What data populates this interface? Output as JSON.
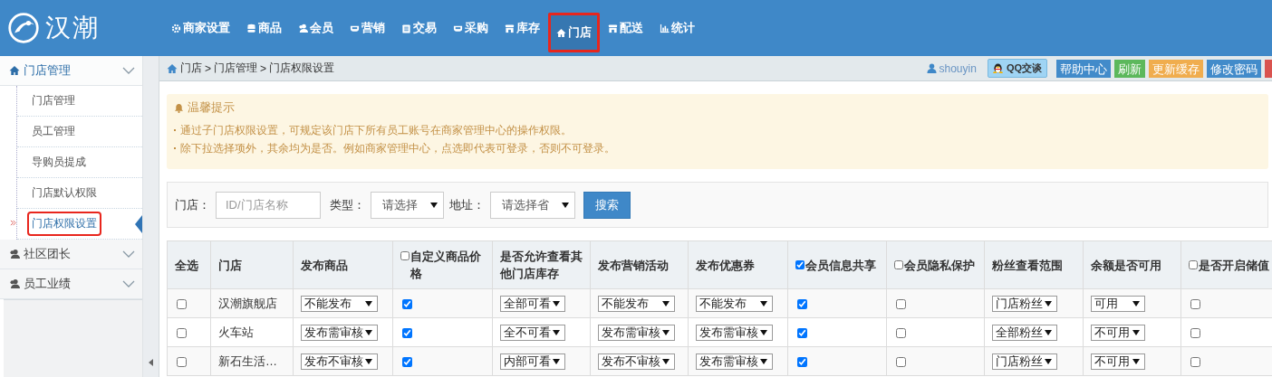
{
  "header": {
    "logo_text": "汉潮",
    "nav": [
      {
        "label": "商家设置",
        "selected": false,
        "highlighted": false
      },
      {
        "label": "商品",
        "selected": false,
        "highlighted": false
      },
      {
        "label": "会员",
        "selected": false,
        "highlighted": false
      },
      {
        "label": "营销",
        "selected": false,
        "highlighted": false
      },
      {
        "label": "交易",
        "selected": false,
        "highlighted": false
      },
      {
        "label": "采购",
        "selected": false,
        "highlighted": false
      },
      {
        "label": "库存",
        "selected": false,
        "highlighted": false
      },
      {
        "label": "门店",
        "selected": true,
        "highlighted": true
      },
      {
        "label": "配送",
        "selected": false,
        "highlighted": false
      },
      {
        "label": "统计",
        "selected": false,
        "highlighted": false
      }
    ]
  },
  "sidebar": {
    "groups": [
      {
        "label": "门店管理",
        "expanded": true,
        "children": [
          {
            "label": "门店管理",
            "selected": false,
            "highlighted": false
          },
          {
            "label": "员工管理",
            "selected": false,
            "highlighted": false
          },
          {
            "label": "导购员提成",
            "selected": false,
            "highlighted": false
          },
          {
            "label": "门店默认权限",
            "selected": false,
            "highlighted": false
          },
          {
            "label": "门店权限设置",
            "selected": true,
            "highlighted": true
          }
        ]
      },
      {
        "label": "社区团长",
        "expanded": false
      },
      {
        "label": "员工业绩",
        "expanded": false
      }
    ]
  },
  "breadcrumb": [
    "门店",
    "门店管理",
    "门店权限设置"
  ],
  "breadcrumb_separators": [
    ">",
    ">"
  ],
  "toolbar": {
    "user": "shouyin",
    "qq_button": "QQ交谈",
    "buttons": [
      {
        "label": "帮助中心",
        "color": "#428bca"
      },
      {
        "label": "刷新",
        "color": "#5cb85c"
      },
      {
        "label": "更新缓存",
        "color": "#f0ad4e"
      },
      {
        "label": "修改密码",
        "color": "#428bca"
      },
      {
        "color": "#d9534f"
      }
    ]
  },
  "tips": {
    "title": "温馨提示",
    "items": [
      "通过子门店权限设置，可规定该门店下所有员工账号在商家管理中心的操作权限。",
      "除下拉选择项外，其余均为是否。例如商家管理中心，点选即代表可登录，否则不可登录。"
    ]
  },
  "filter": {
    "store_label": "门店：",
    "store_placeholder": "ID/门店名称",
    "type_label": "类型：",
    "type_value": "请选择",
    "address_label": "地址：",
    "address_value": "请选择省",
    "search_button": "搜索"
  },
  "table": {
    "columns": [
      {
        "kind": "text",
        "label": "全选"
      },
      {
        "kind": "text",
        "label": "门店"
      },
      {
        "kind": "text",
        "label": "发布商品"
      },
      {
        "kind": "check",
        "label": "自定义商品价格",
        "checked": false
      },
      {
        "kind": "text",
        "label": "是否允许查看其他门店库存"
      },
      {
        "kind": "text",
        "label": "发布营销活动"
      },
      {
        "kind": "text",
        "label": "发布优惠券"
      },
      {
        "kind": "check",
        "label": "会员信息共享",
        "checked": true
      },
      {
        "kind": "check",
        "label": "会员隐私保护",
        "checked": false
      },
      {
        "kind": "text",
        "label": "粉丝查看范围"
      },
      {
        "kind": "text",
        "label": "余额是否可用"
      },
      {
        "kind": "check",
        "label": "是否开启储值",
        "checked": false
      }
    ],
    "rows": [
      {
        "cells": [
          {
            "kind": "check",
            "checked": false
          },
          {
            "kind": "text",
            "text": "汉潮旗舰店"
          },
          {
            "kind": "select",
            "value": "不能发布"
          },
          {
            "kind": "check",
            "checked": true
          },
          {
            "kind": "select",
            "value": "全部可看"
          },
          {
            "kind": "select",
            "value": "不能发布"
          },
          {
            "kind": "select",
            "value": "不能发布"
          },
          {
            "kind": "check",
            "checked": true
          },
          {
            "kind": "check",
            "checked": false
          },
          {
            "kind": "select",
            "value": "门店粉丝"
          },
          {
            "kind": "select",
            "value": "可用"
          },
          {
            "kind": "check",
            "checked": false
          }
        ]
      },
      {
        "cells": [
          {
            "kind": "check",
            "checked": false
          },
          {
            "kind": "text",
            "text": "火车站"
          },
          {
            "kind": "select",
            "value": "发布需审核"
          },
          {
            "kind": "check",
            "checked": true
          },
          {
            "kind": "select",
            "value": "全不可看"
          },
          {
            "kind": "select",
            "value": "发布需审核"
          },
          {
            "kind": "select",
            "value": "发布需审核"
          },
          {
            "kind": "check",
            "checked": true
          },
          {
            "kind": "check",
            "checked": false
          },
          {
            "kind": "select",
            "value": "全部粉丝"
          },
          {
            "kind": "select",
            "value": "不可用"
          },
          {
            "kind": "check",
            "checked": false
          }
        ]
      },
      {
        "cells": [
          {
            "kind": "check",
            "checked": false
          },
          {
            "kind": "text",
            "text": "新石生活…"
          },
          {
            "kind": "select",
            "value": "发布不审核"
          },
          {
            "kind": "check",
            "checked": true
          },
          {
            "kind": "select",
            "value": "内部可看"
          },
          {
            "kind": "select",
            "value": "发布不审核"
          },
          {
            "kind": "select",
            "value": "发布需审核"
          },
          {
            "kind": "check",
            "checked": true
          },
          {
            "kind": "check",
            "checked": false
          },
          {
            "kind": "select",
            "value": "门店粉丝"
          },
          {
            "kind": "select",
            "value": "不可用"
          },
          {
            "kind": "check",
            "checked": false
          }
        ]
      }
    ]
  }
}
